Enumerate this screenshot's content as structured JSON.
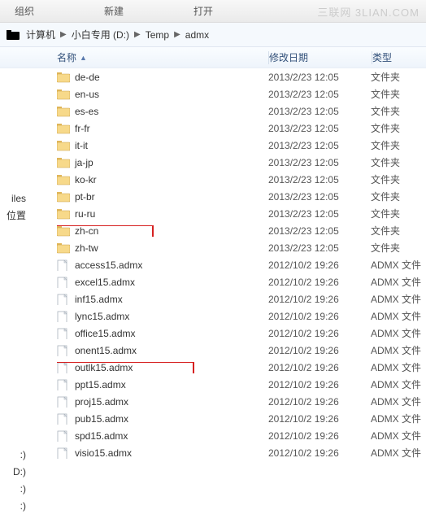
{
  "toolbar": {
    "organize": "组织",
    "new": "新建",
    "open": "打开"
  },
  "watermark": "三联网 3LIAN.COM",
  "breadcrumb": {
    "computer": "计算机",
    "drive": "小白专用 (D:)",
    "folder1": "Temp",
    "folder2": "admx"
  },
  "columns": {
    "name": "名称",
    "modified": "修改日期",
    "type": "类型"
  },
  "side": [
    "",
    "",
    "",
    "",
    "iles",
    "位置",
    "",
    "",
    "",
    "",
    "",
    "",
    "",
    "",
    "",
    "",
    "",
    "",
    "",
    ":)",
    "D:)",
    ":)",
    ":)",
    ""
  ],
  "rows": [
    {
      "icon": "folder",
      "name": "de-de",
      "date": "2013/2/23 12:05",
      "type": "文件夹"
    },
    {
      "icon": "folder",
      "name": "en-us",
      "date": "2013/2/23 12:05",
      "type": "文件夹"
    },
    {
      "icon": "folder",
      "name": "es-es",
      "date": "2013/2/23 12:05",
      "type": "文件夹"
    },
    {
      "icon": "folder",
      "name": "fr-fr",
      "date": "2013/2/23 12:05",
      "type": "文件夹"
    },
    {
      "icon": "folder",
      "name": "it-it",
      "date": "2013/2/23 12:05",
      "type": "文件夹"
    },
    {
      "icon": "folder",
      "name": "ja-jp",
      "date": "2013/2/23 12:05",
      "type": "文件夹"
    },
    {
      "icon": "folder",
      "name": "ko-kr",
      "date": "2013/2/23 12:05",
      "type": "文件夹"
    },
    {
      "icon": "folder",
      "name": "pt-br",
      "date": "2013/2/23 12:05",
      "type": "文件夹"
    },
    {
      "icon": "folder",
      "name": "ru-ru",
      "date": "2013/2/23 12:05",
      "type": "文件夹"
    },
    {
      "icon": "folder",
      "name": "zh-cn",
      "date": "2013/2/23 12:05",
      "type": "文件夹",
      "hl": "zhcn"
    },
    {
      "icon": "folder",
      "name": "zh-tw",
      "date": "2013/2/23 12:05",
      "type": "文件夹"
    },
    {
      "icon": "file",
      "name": "access15.admx",
      "date": "2012/10/2 19:26",
      "type": "ADMX 文件"
    },
    {
      "icon": "file",
      "name": "excel15.admx",
      "date": "2012/10/2 19:26",
      "type": "ADMX 文件"
    },
    {
      "icon": "file",
      "name": "inf15.admx",
      "date": "2012/10/2 19:26",
      "type": "ADMX 文件"
    },
    {
      "icon": "file",
      "name": "lync15.admx",
      "date": "2012/10/2 19:26",
      "type": "ADMX 文件"
    },
    {
      "icon": "file",
      "name": "office15.admx",
      "date": "2012/10/2 19:26",
      "type": "ADMX 文件"
    },
    {
      "icon": "file",
      "name": "onent15.admx",
      "date": "2012/10/2 19:26",
      "type": "ADMX 文件"
    },
    {
      "icon": "file",
      "name": "outlk15.admx",
      "date": "2012/10/2 19:26",
      "type": "ADMX 文件",
      "hl": "outlk"
    },
    {
      "icon": "file",
      "name": "ppt15.admx",
      "date": "2012/10/2 19:26",
      "type": "ADMX 文件"
    },
    {
      "icon": "file",
      "name": "proj15.admx",
      "date": "2012/10/2 19:26",
      "type": "ADMX 文件"
    },
    {
      "icon": "file",
      "name": "pub15.admx",
      "date": "2012/10/2 19:26",
      "type": "ADMX 文件"
    },
    {
      "icon": "file",
      "name": "spd15.admx",
      "date": "2012/10/2 19:26",
      "type": "ADMX 文件"
    },
    {
      "icon": "file",
      "name": "visio15.admx",
      "date": "2012/10/2 19:26",
      "type": "ADMX 文件"
    }
  ]
}
